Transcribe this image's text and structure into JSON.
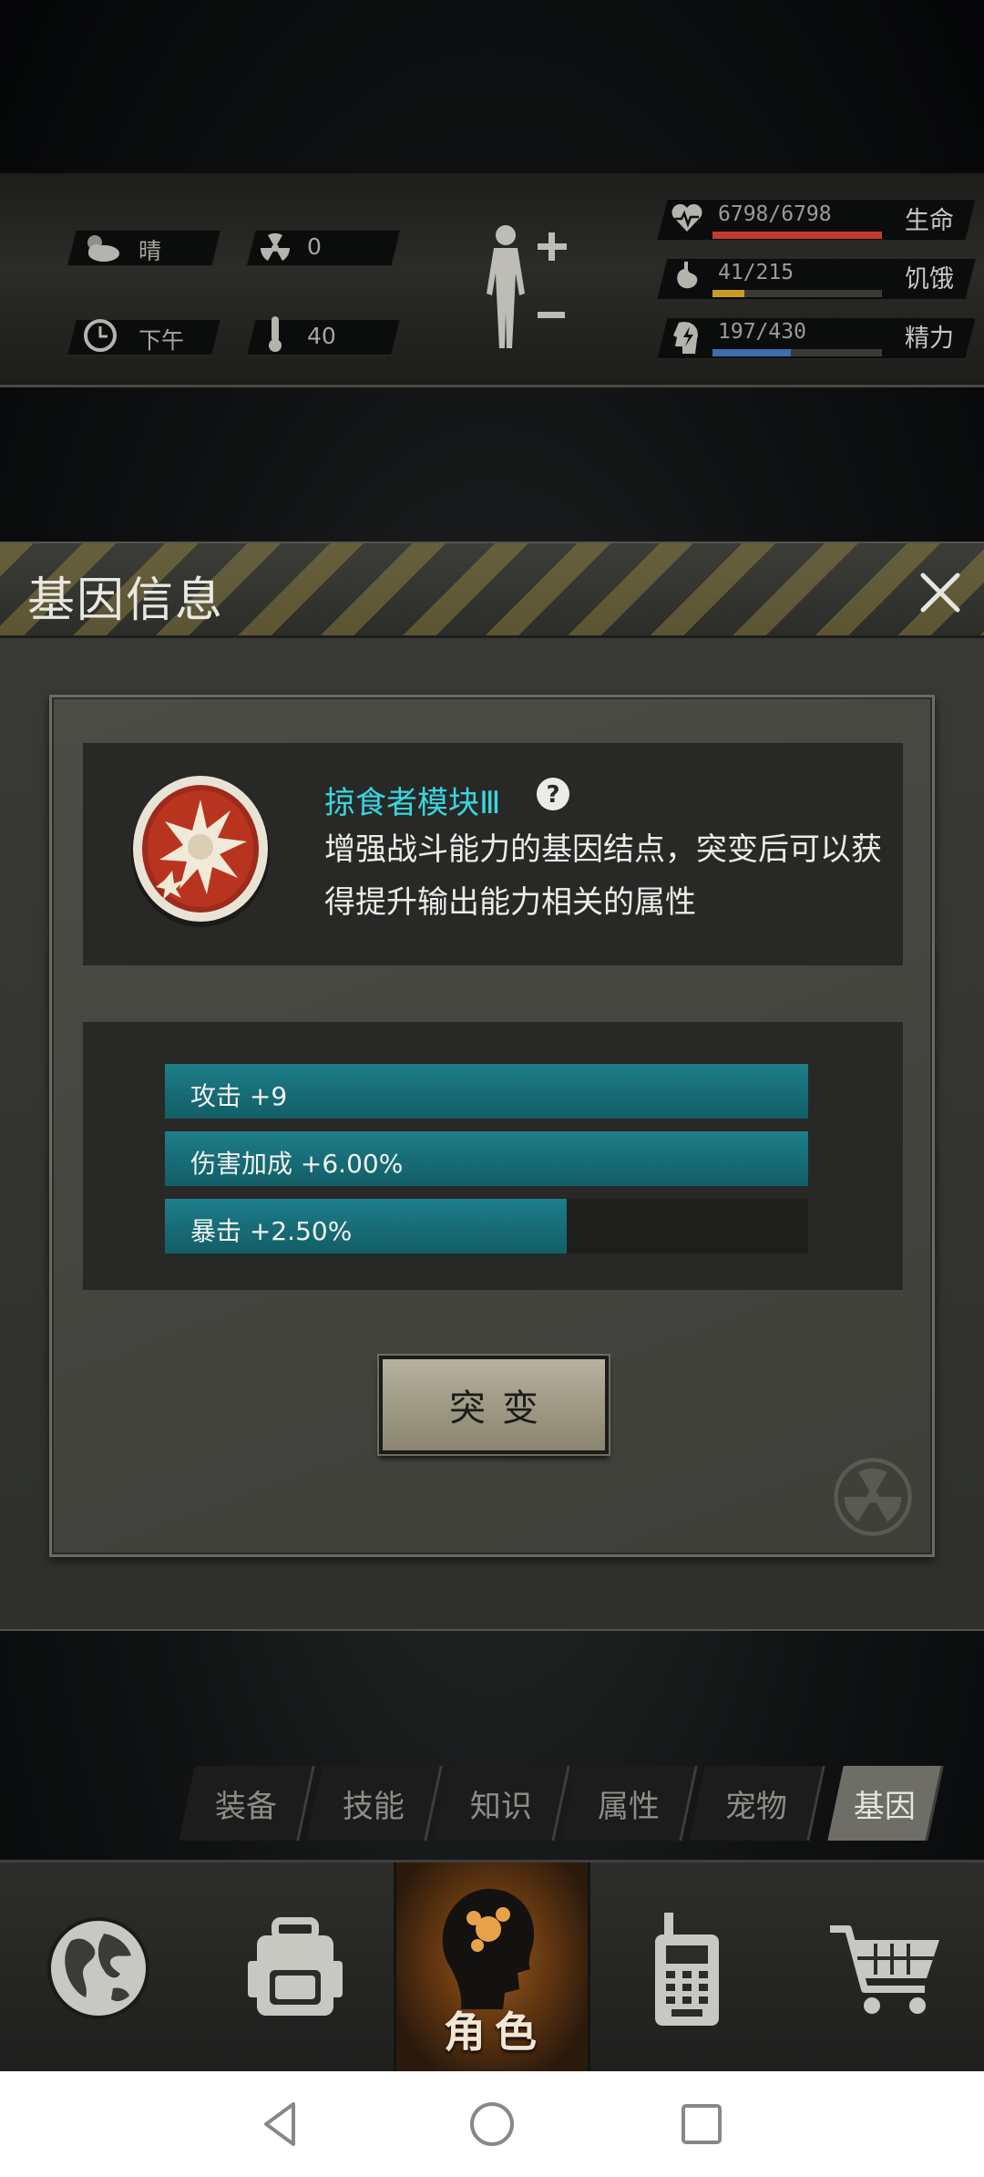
{
  "hud": {
    "weather": "晴",
    "radiation": "0",
    "time_of_day": "下午",
    "temperature": "40",
    "stats": [
      {
        "value": "6798/6798",
        "label": "生命",
        "fill": 1.0,
        "color": "#c23a2e",
        "icon": "heart-icon"
      },
      {
        "value": "41/215",
        "label": "饥饿",
        "fill": 0.19,
        "color": "#c79a2a",
        "icon": "stomach-icon"
      },
      {
        "value": "197/430",
        "label": "精力",
        "fill": 0.46,
        "color": "#3b6fb0",
        "icon": "energy-icon"
      }
    ]
  },
  "modal": {
    "title": "基因信息",
    "gene_name": "掠食者模块Ⅲ",
    "gene_description": "增强战斗能力的基因结点，突变后可以获得提升输出能力相关的属性",
    "bonuses": [
      {
        "label": "攻击 +9",
        "fill": 1.0
      },
      {
        "label": "伤害加成 +6.00%",
        "fill": 1.0
      },
      {
        "label": "暴击 +2.50%",
        "fill": 0.625
      }
    ],
    "mutate_label": "突变"
  },
  "subtabs": [
    {
      "label": "装备",
      "active": false
    },
    {
      "label": "技能",
      "active": false
    },
    {
      "label": "知识",
      "active": false
    },
    {
      "label": "属性",
      "active": false
    },
    {
      "label": "宠物",
      "active": false
    },
    {
      "label": "基因",
      "active": true
    }
  ],
  "bottom_nav": {
    "character_label": "角色",
    "items": [
      "globe-icon",
      "backpack-icon",
      "character-icon",
      "radio-icon",
      "shop-cart-icon"
    ]
  },
  "colors": {
    "accent_teal": "#38d6e0",
    "bar_teal": "#176d77",
    "nav_active": "#9a5a18"
  }
}
